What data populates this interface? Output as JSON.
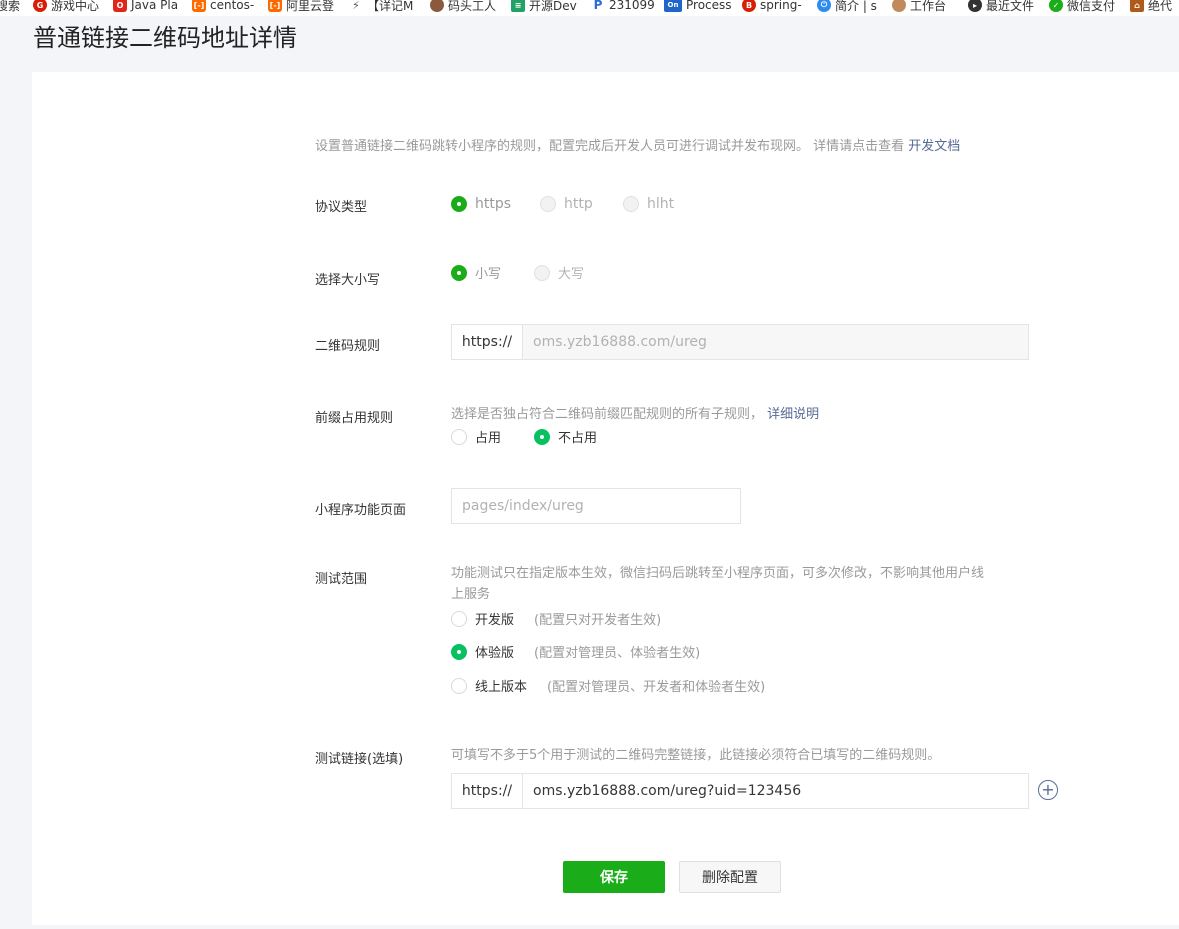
{
  "bookmarks": [
    {
      "label": "搜索",
      "icon": "search-icon",
      "color": "#ffffff"
    },
    {
      "label": "游戏中心",
      "icon": "game-icon",
      "color": "#d81e06"
    },
    {
      "label": "Java Pla",
      "icon": "oracle-icon",
      "color": "#e0261b"
    },
    {
      "label": "centos-",
      "icon": "aliyun-icon",
      "color": "#ff6a00"
    },
    {
      "label": "阿里云登",
      "icon": "aliyun-icon",
      "color": "#ff6a00"
    },
    {
      "label": "【详记M",
      "icon": "bookmark-icon",
      "color": "#555555"
    },
    {
      "label": "码头工人",
      "icon": "avatar-icon",
      "color": "#8a5a3c"
    },
    {
      "label": "开源Dev",
      "icon": "devops-icon",
      "color": "#21a366"
    },
    {
      "label": "231099",
      "icon": "p-icon",
      "color": "#2b6cd8"
    },
    {
      "label": "Process",
      "icon": "onenote-icon",
      "color": "#1f66c9"
    },
    {
      "label": "spring-",
      "icon": "spring-icon",
      "color": "#d81e06"
    },
    {
      "label": "简介 | s",
      "icon": "power-icon",
      "color": "#2d8cf0"
    },
    {
      "label": "工作台",
      "icon": "avatar-icon",
      "color": "#c08a5a"
    },
    {
      "label": "最近文件",
      "icon": "file-icon",
      "color": "#333333"
    },
    {
      "label": "微信支付",
      "icon": "wechat-pay-icon",
      "color": "#1aad19"
    },
    {
      "label": "绝代",
      "icon": "house-icon",
      "color": "#b05a1a"
    }
  ],
  "page_title": "普通链接二维码地址详情",
  "intro": {
    "text": "设置普通链接二维码跳转小程序的规则，配置完成后开发人员可进行调试并发布现网。 详情请点击查看 ",
    "link": "开发文档"
  },
  "protocol": {
    "label": "协议类型",
    "options": [
      "https",
      "http",
      "hlht"
    ]
  },
  "case": {
    "label": "选择大小写",
    "options": [
      "小写",
      "大写"
    ]
  },
  "qr_rule": {
    "label": "二维码规则",
    "prefix": "https://",
    "value": "oms.yzb16888.com/ureg"
  },
  "prefix_rule": {
    "label": "前缀占用规则",
    "desc": "选择是否独占符合二维码前缀匹配规则的所有子规则，",
    "link": "详细说明",
    "options": [
      "占用",
      "不占用"
    ]
  },
  "page": {
    "label": "小程序功能页面",
    "placeholder": "pages/index/ureg"
  },
  "test_scope": {
    "label": "测试范围",
    "desc_line1": "功能测试只在指定版本生效，微信扫码后跳转至小程序页面，可多次修改，不影响其他用户线",
    "desc_line2": "上服务",
    "options": [
      {
        "name": "开发版",
        "note": "(配置只对开发者生效)"
      },
      {
        "name": "体验版",
        "note": "(配置对管理员、体验者生效)"
      },
      {
        "name": "线上版本",
        "note": "(配置对管理员、开发者和体验者生效)"
      }
    ]
  },
  "test_link": {
    "label": "测试链接(选填)",
    "desc": "可填写不多于5个用于测试的二维码完整链接，此链接必须符合已填写的二维码规则。",
    "prefix": "https://",
    "value": "oms.yzb16888.com/ureg?uid=123456"
  },
  "buttons": {
    "save": "保存",
    "delete": "删除配置"
  },
  "colors": {
    "accent": "#1aad19",
    "link": "#576b95"
  }
}
